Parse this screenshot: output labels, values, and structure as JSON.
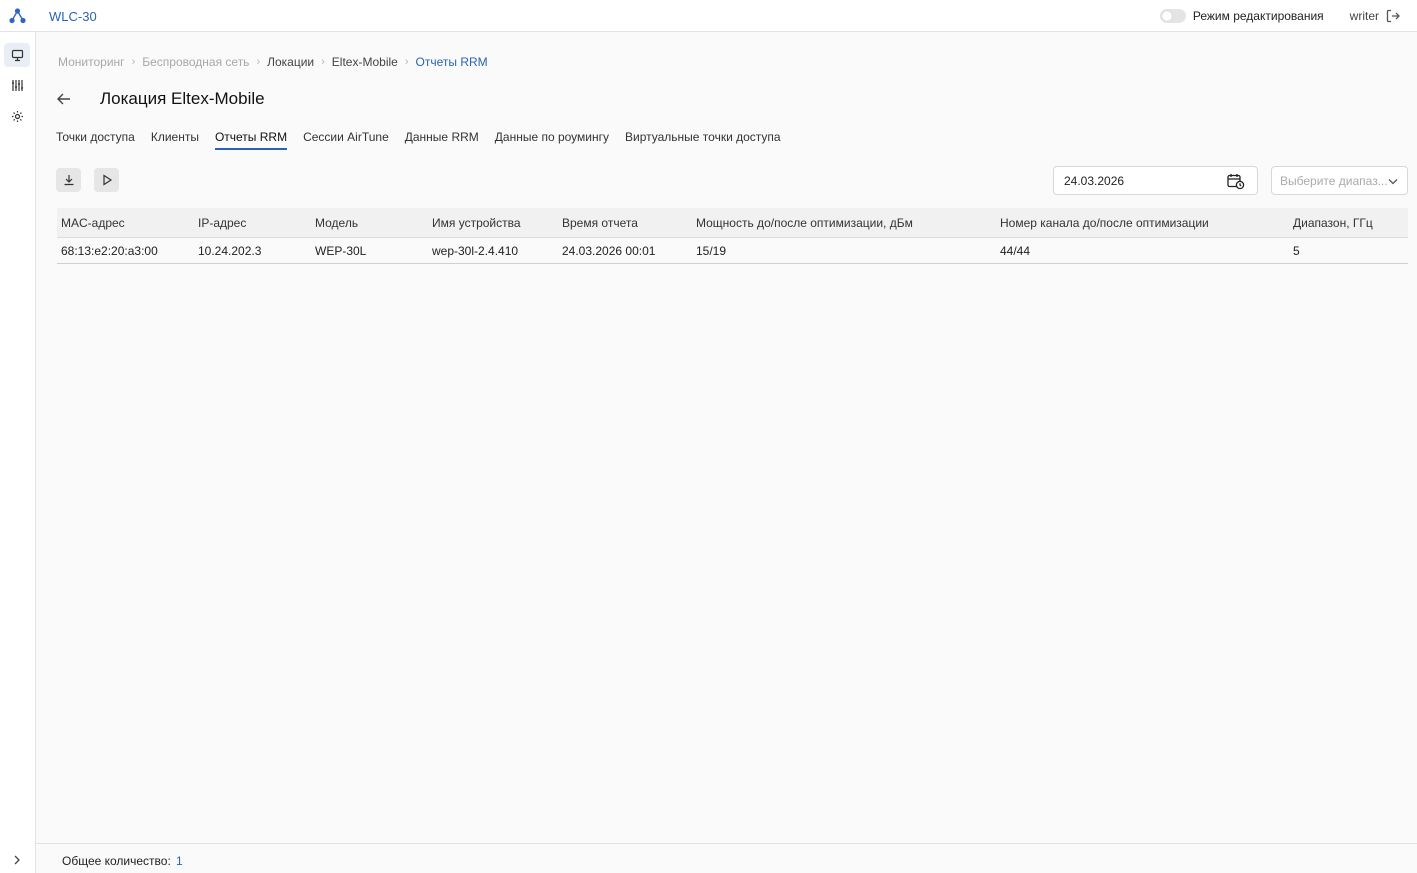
{
  "app": {
    "title": "WLC-30"
  },
  "topbar": {
    "edit_mode_label": "Режим редактирования",
    "edit_mode_on": false,
    "username": "writer"
  },
  "sidebar": {
    "items": [
      "monitor-icon",
      "equalizer-icon",
      "settings-icon"
    ],
    "active": 0
  },
  "breadcrumb": [
    "Мониторинг",
    "Беспроводная сеть",
    "Локации",
    "Eltex-Mobile",
    "Отчеты RRM"
  ],
  "page": {
    "title": "Локация Eltex-Mobile"
  },
  "tabs": [
    {
      "label": "Точки доступа",
      "active": false
    },
    {
      "label": "Клиенты",
      "active": false
    },
    {
      "label": "Отчеты RRM",
      "active": true
    },
    {
      "label": "Сессии AirTune",
      "active": false
    },
    {
      "label": "Данные RRM",
      "active": false
    },
    {
      "label": "Данные по роумингу",
      "active": false
    },
    {
      "label": "Виртуальные точки доступа",
      "active": false
    }
  ],
  "filters": {
    "date": "24.03.2026",
    "range_placeholder": "Выберите диапаз..."
  },
  "table": {
    "columns": [
      "MAC-адрес",
      "IP-адрес",
      "Модель",
      "Имя устройства",
      "Время отчета",
      "Мощность до/после оптимизации, дБм",
      "Номер канала до/после оптимизации",
      "Диапазон, ГГц"
    ],
    "rows": [
      [
        "68:13:e2:20:a3:00",
        "10.24.202.3",
        "WEP-30L",
        "wep-30l-2.4.410",
        "24.03.2026 00:01",
        "15/19",
        "44/44",
        "5"
      ]
    ]
  },
  "footer": {
    "total_label": "Общее количество:",
    "total_value": "1"
  },
  "colors": {
    "accent": "#2a62b8",
    "logo": "#2f66c4"
  }
}
